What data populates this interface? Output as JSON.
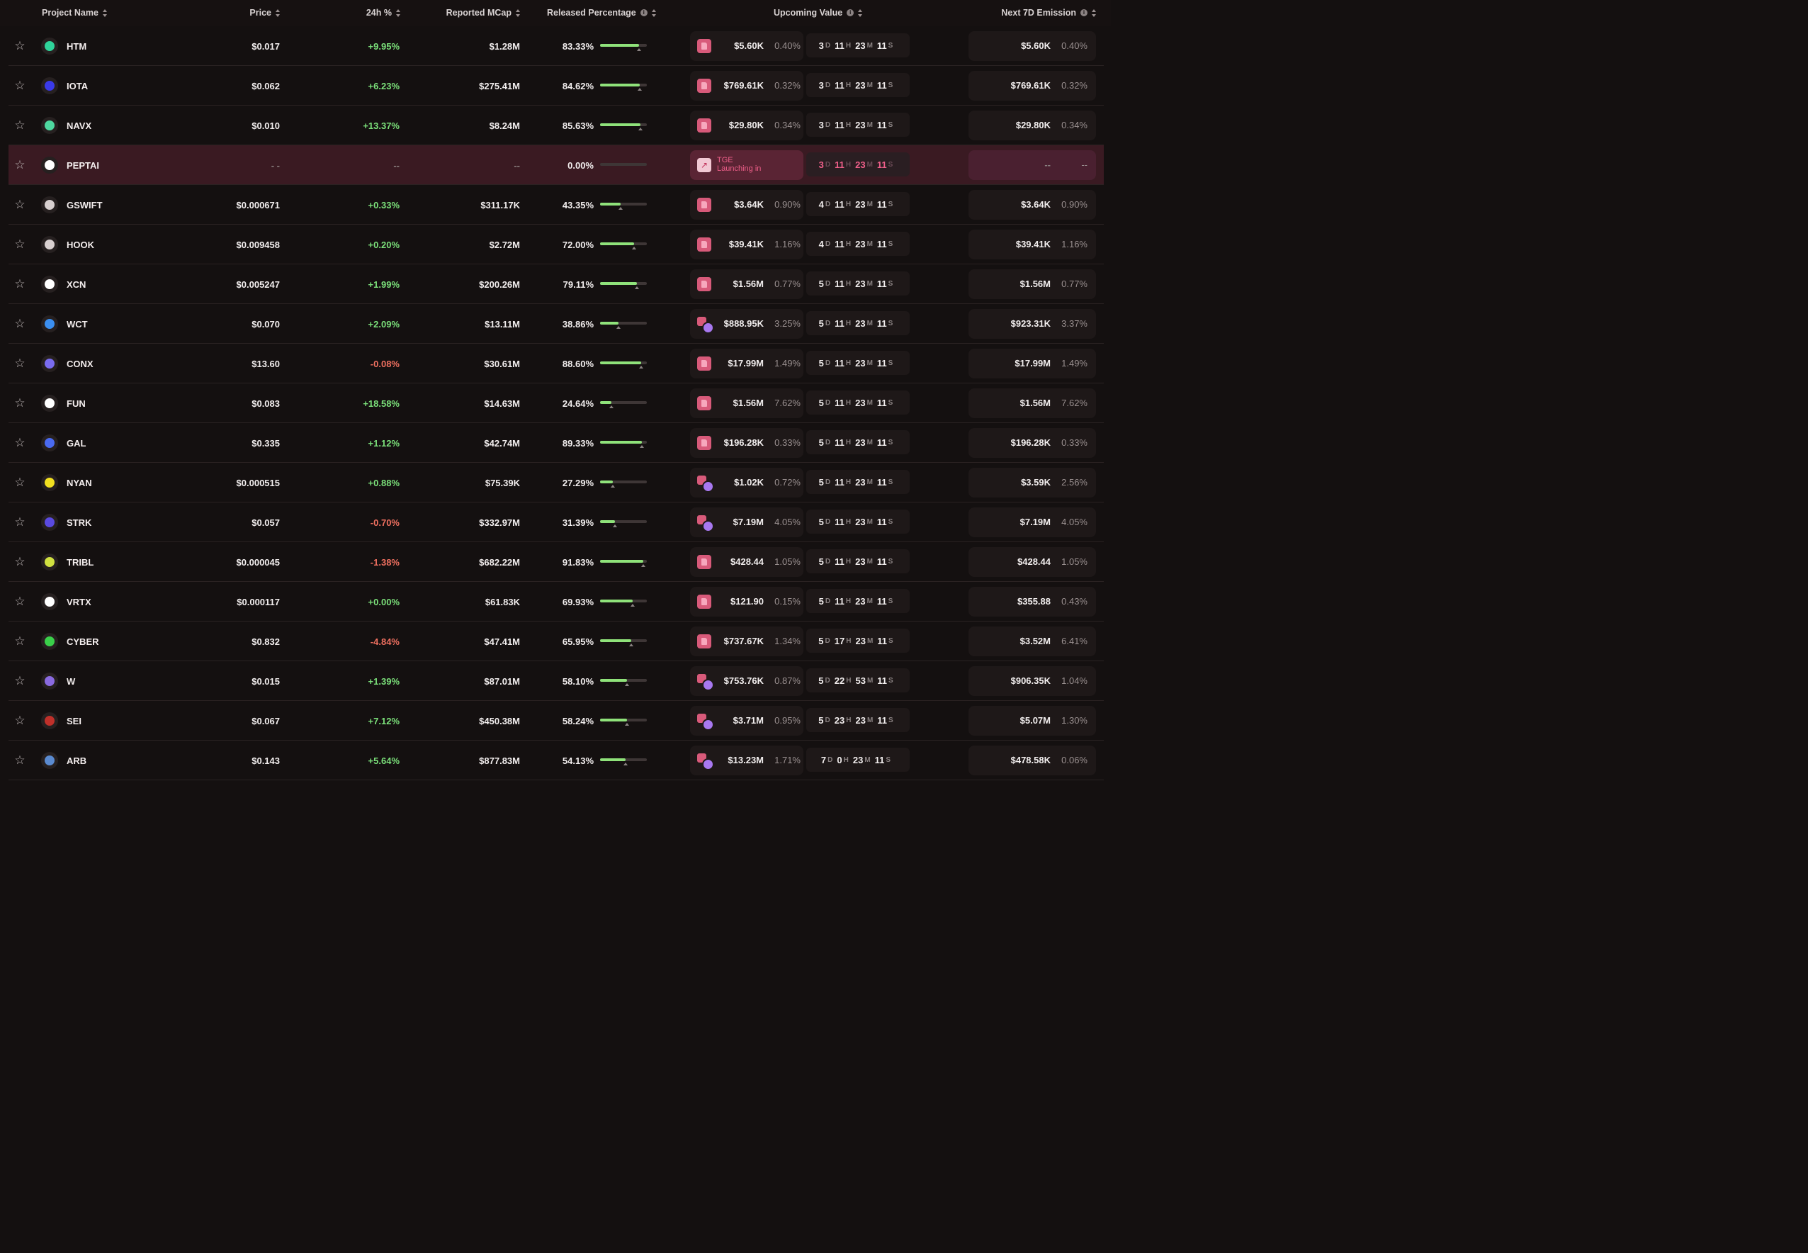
{
  "headers": {
    "project": "Project Name",
    "price": "Price",
    "change": "24h %",
    "mcap": "Reported MCap",
    "released": "Released Percentage",
    "upcoming": "Upcoming Value",
    "next7d": "Next 7D Emission"
  },
  "rows": [
    {
      "sym": "HTM",
      "price": "$0.017",
      "chg": "+9.95%",
      "mcap": "$1.28M",
      "rel": "83.33%",
      "relv": 0.8333,
      "up": "$5.60K",
      "uppct": "0.40%",
      "icon": "single",
      "d": "3",
      "h": "11",
      "m": "23",
      "s": "11",
      "nx": "$5.60K",
      "nxpct": "0.40%",
      "logo": "#2fd39a"
    },
    {
      "sym": "IOTA",
      "price": "$0.062",
      "chg": "+6.23%",
      "mcap": "$275.41M",
      "rel": "84.62%",
      "relv": 0.8462,
      "up": "$769.61K",
      "uppct": "0.32%",
      "icon": "single",
      "d": "3",
      "h": "11",
      "m": "23",
      "s": "11",
      "nx": "$769.61K",
      "nxpct": "0.32%",
      "logo": "#3a3ae8"
    },
    {
      "sym": "NAVX",
      "price": "$0.010",
      "chg": "+13.37%",
      "mcap": "$8.24M",
      "rel": "85.63%",
      "relv": 0.8563,
      "up": "$29.80K",
      "uppct": "0.34%",
      "icon": "single",
      "d": "3",
      "h": "11",
      "m": "23",
      "s": "11",
      "nx": "$29.80K",
      "nxpct": "0.34%",
      "logo": "#4ed8a0"
    },
    {
      "sym": "PEPTAI",
      "price": "- -",
      "chg": "--",
      "mcap": "--",
      "rel": "0.00%",
      "relv": 0,
      "up": "",
      "uppct": "",
      "icon": "tge",
      "tge1": "TGE",
      "tge2": "Launching in",
      "d": "3",
      "h": "11",
      "m": "23",
      "s": "11",
      "nx": "--",
      "nxpct": "--",
      "logo": "#ffffff",
      "hl": true
    },
    {
      "sym": "GSWIFT",
      "price": "$0.000671",
      "chg": "+0.33%",
      "mcap": "$311.17K",
      "rel": "43.35%",
      "relv": 0.4335,
      "up": "$3.64K",
      "uppct": "0.90%",
      "icon": "single",
      "d": "4",
      "h": "11",
      "m": "23",
      "s": "11",
      "nx": "$3.64K",
      "nxpct": "0.90%",
      "logo": "#d8d0d0"
    },
    {
      "sym": "HOOK",
      "price": "$0.009458",
      "chg": "+0.20%",
      "mcap": "$2.72M",
      "rel": "72.00%",
      "relv": 0.72,
      "up": "$39.41K",
      "uppct": "1.16%",
      "icon": "single",
      "d": "4",
      "h": "11",
      "m": "23",
      "s": "11",
      "nx": "$39.41K",
      "nxpct": "1.16%",
      "logo": "#d8d0d0"
    },
    {
      "sym": "XCN",
      "price": "$0.005247",
      "chg": "+1.99%",
      "mcap": "$200.26M",
      "rel": "79.11%",
      "relv": 0.7911,
      "up": "$1.56M",
      "uppct": "0.77%",
      "icon": "single",
      "d": "5",
      "h": "11",
      "m": "23",
      "s": "11",
      "nx": "$1.56M",
      "nxpct": "0.77%",
      "logo": "#ffffff"
    },
    {
      "sym": "WCT",
      "price": "$0.070",
      "chg": "+2.09%",
      "mcap": "$13.11M",
      "rel": "38.86%",
      "relv": 0.3886,
      "up": "$888.95K",
      "uppct": "3.25%",
      "icon": "multi",
      "d": "5",
      "h": "11",
      "m": "23",
      "s": "11",
      "nx": "$923.31K",
      "nxpct": "3.37%",
      "logo": "#3b8ff0"
    },
    {
      "sym": "CONX",
      "price": "$13.60",
      "chg": "-0.08%",
      "mcap": "$30.61M",
      "rel": "88.60%",
      "relv": 0.886,
      "up": "$17.99M",
      "uppct": "1.49%",
      "icon": "single",
      "d": "5",
      "h": "11",
      "m": "23",
      "s": "11",
      "nx": "$17.99M",
      "nxpct": "1.49%",
      "logo": "#7a6cf0"
    },
    {
      "sym": "FUN",
      "price": "$0.083",
      "chg": "+18.58%",
      "mcap": "$14.63M",
      "rel": "24.64%",
      "relv": 0.2464,
      "up": "$1.56M",
      "uppct": "7.62%",
      "icon": "single",
      "d": "5",
      "h": "11",
      "m": "23",
      "s": "11",
      "nx": "$1.56M",
      "nxpct": "7.62%",
      "logo": "#ffffff"
    },
    {
      "sym": "GAL",
      "price": "$0.335",
      "chg": "+1.12%",
      "mcap": "$42.74M",
      "rel": "89.33%",
      "relv": 0.8933,
      "up": "$196.28K",
      "uppct": "0.33%",
      "icon": "single",
      "d": "5",
      "h": "11",
      "m": "23",
      "s": "11",
      "nx": "$196.28K",
      "nxpct": "0.33%",
      "logo": "#4a6af0"
    },
    {
      "sym": "NYAN",
      "price": "$0.000515",
      "chg": "+0.88%",
      "mcap": "$75.39K",
      "rel": "27.29%",
      "relv": 0.2729,
      "up": "$1.02K",
      "uppct": "0.72%",
      "icon": "multi",
      "d": "5",
      "h": "11",
      "m": "23",
      "s": "11",
      "nx": "$3.59K",
      "nxpct": "2.56%",
      "logo": "#f2e020"
    },
    {
      "sym": "STRK",
      "price": "$0.057",
      "chg": "-0.70%",
      "mcap": "$332.97M",
      "rel": "31.39%",
      "relv": 0.3139,
      "up": "$7.19M",
      "uppct": "4.05%",
      "icon": "multi",
      "d": "5",
      "h": "11",
      "m": "23",
      "s": "11",
      "nx": "$7.19M",
      "nxpct": "4.05%",
      "logo": "#5a4ae0"
    },
    {
      "sym": "TRIBL",
      "price": "$0.000045",
      "chg": "-1.38%",
      "mcap": "$682.22M",
      "rel": "91.83%",
      "relv": 0.9183,
      "up": "$428.44",
      "uppct": "1.05%",
      "icon": "single",
      "d": "5",
      "h": "11",
      "m": "23",
      "s": "11",
      "nx": "$428.44",
      "nxpct": "1.05%",
      "logo": "#d0e040"
    },
    {
      "sym": "VRTX",
      "price": "$0.000117",
      "chg": "+0.00%",
      "mcap": "$61.83K",
      "rel": "69.93%",
      "relv": 0.6993,
      "up": "$121.90",
      "uppct": "0.15%",
      "icon": "single",
      "d": "5",
      "h": "11",
      "m": "23",
      "s": "11",
      "nx": "$355.88",
      "nxpct": "0.43%",
      "logo": "#ffffff"
    },
    {
      "sym": "CYBER",
      "price": "$0.832",
      "chg": "-4.84%",
      "mcap": "$47.41M",
      "rel": "65.95%",
      "relv": 0.6595,
      "up": "$737.67K",
      "uppct": "1.34%",
      "icon": "single",
      "d": "5",
      "h": "17",
      "m": "23",
      "s": "11",
      "nx": "$3.52M",
      "nxpct": "6.41%",
      "logo": "#3ad04a"
    },
    {
      "sym": "W",
      "price": "$0.015",
      "chg": "+1.39%",
      "mcap": "$87.01M",
      "rel": "58.10%",
      "relv": 0.581,
      "up": "$753.76K",
      "uppct": "0.87%",
      "icon": "multi",
      "d": "5",
      "h": "22",
      "m": "53",
      "s": "11",
      "nx": "$906.35K",
      "nxpct": "1.04%",
      "logo": "#8a6ae0"
    },
    {
      "sym": "SEI",
      "price": "$0.067",
      "chg": "+7.12%",
      "mcap": "$450.38M",
      "rel": "58.24%",
      "relv": 0.5824,
      "up": "$3.71M",
      "uppct": "0.95%",
      "icon": "multi",
      "d": "5",
      "h": "23",
      "m": "23",
      "s": "11",
      "nx": "$5.07M",
      "nxpct": "1.30%",
      "logo": "#c0302a"
    },
    {
      "sym": "ARB",
      "price": "$0.143",
      "chg": "+5.64%",
      "mcap": "$877.83M",
      "rel": "54.13%",
      "relv": 0.5413,
      "up": "$13.23M",
      "uppct": "1.71%",
      "icon": "multi",
      "d": "7",
      "h": "0",
      "m": "23",
      "s": "11",
      "nx": "$478.58K",
      "nxpct": "0.06%",
      "logo": "#5a8ad0"
    }
  ],
  "units": {
    "d": "D",
    "h": "H",
    "m": "M",
    "s": "S"
  },
  "colors": {
    "positive": "#7be07a",
    "negative": "#f07060",
    "bar": "#8fe27a",
    "accent": "#ef5f8a"
  }
}
